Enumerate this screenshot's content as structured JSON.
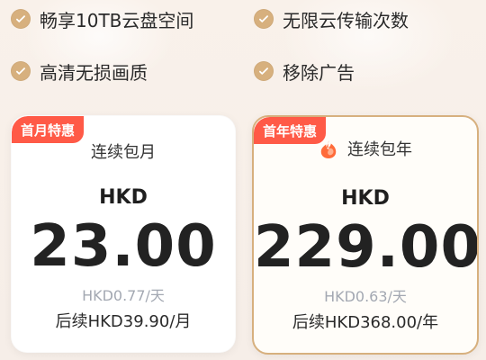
{
  "benefits": [
    "畅享10TB云盘空间",
    "无限云传输次数",
    "高清无损画质",
    "移除广告"
  ],
  "plans": [
    {
      "badge": "首月特惠",
      "title": "连续包月",
      "currency": "HKD",
      "price": "23.00",
      "daily": "HKD0.77/天",
      "renewal": "后续HKD39.90/月"
    },
    {
      "badge": "首年特惠",
      "title": "连续包年",
      "icon": "fire-icon",
      "currency": "HKD",
      "price": "229.00",
      "daily": "HKD0.63/天",
      "renewal": "后续HKD368.00/年"
    }
  ],
  "colors": {
    "accent_gold": "#d7b07e",
    "badge_red": "#ff5a47",
    "fire_orange": "#ff6b3a"
  }
}
